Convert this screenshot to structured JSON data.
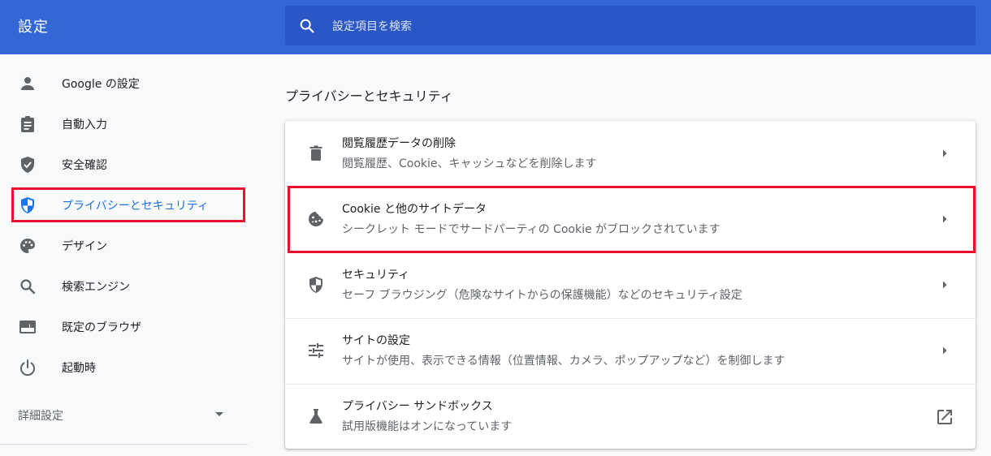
{
  "header": {
    "title": "設定",
    "search_placeholder": "設定項目を検索"
  },
  "sidebar": {
    "items": [
      {
        "label": "Google の設定",
        "icon": "person-icon"
      },
      {
        "label": "自動入力",
        "icon": "clipboard-icon"
      },
      {
        "label": "安全確認",
        "icon": "shield-check-icon"
      },
      {
        "label": "プライバシーとセキュリティ",
        "icon": "privacy-shield-icon",
        "active": true
      },
      {
        "label": "デザイン",
        "icon": "palette-icon"
      },
      {
        "label": "検索エンジン",
        "icon": "search-icon"
      },
      {
        "label": "既定のブラウザ",
        "icon": "browser-icon"
      },
      {
        "label": "起動時",
        "icon": "power-icon"
      }
    ],
    "advanced_label": "詳細設定"
  },
  "main": {
    "section_title": "プライバシーとセキュリティ",
    "rows": [
      {
        "title": "閲覧履歴データの削除",
        "subtitle": "閲覧履歴、Cookie、キャッシュなどを削除します",
        "icon": "trash-icon"
      },
      {
        "title": "Cookie と他のサイトデータ",
        "subtitle": "シークレット モードでサードパーティの Cookie がブロックされています",
        "icon": "cookie-icon"
      },
      {
        "title": "セキュリティ",
        "subtitle": "セーフ ブラウジング（危険なサイトからの保護機能）などのセキュリティ設定",
        "icon": "security-shield-icon"
      },
      {
        "title": "サイトの設定",
        "subtitle": "サイトが使用、表示できる情報（位置情報、カメラ、ポップアップなど）を制御します",
        "icon": "tune-icon"
      },
      {
        "title": "プライバシー サンドボックス",
        "subtitle": "試用版機能はオンになっています",
        "icon": "flask-icon"
      }
    ]
  },
  "colors": {
    "header_bg": "#3367d6",
    "search_bg": "#2a56c6",
    "accent": "#1a73e8",
    "highlight": "#e8112d"
  }
}
